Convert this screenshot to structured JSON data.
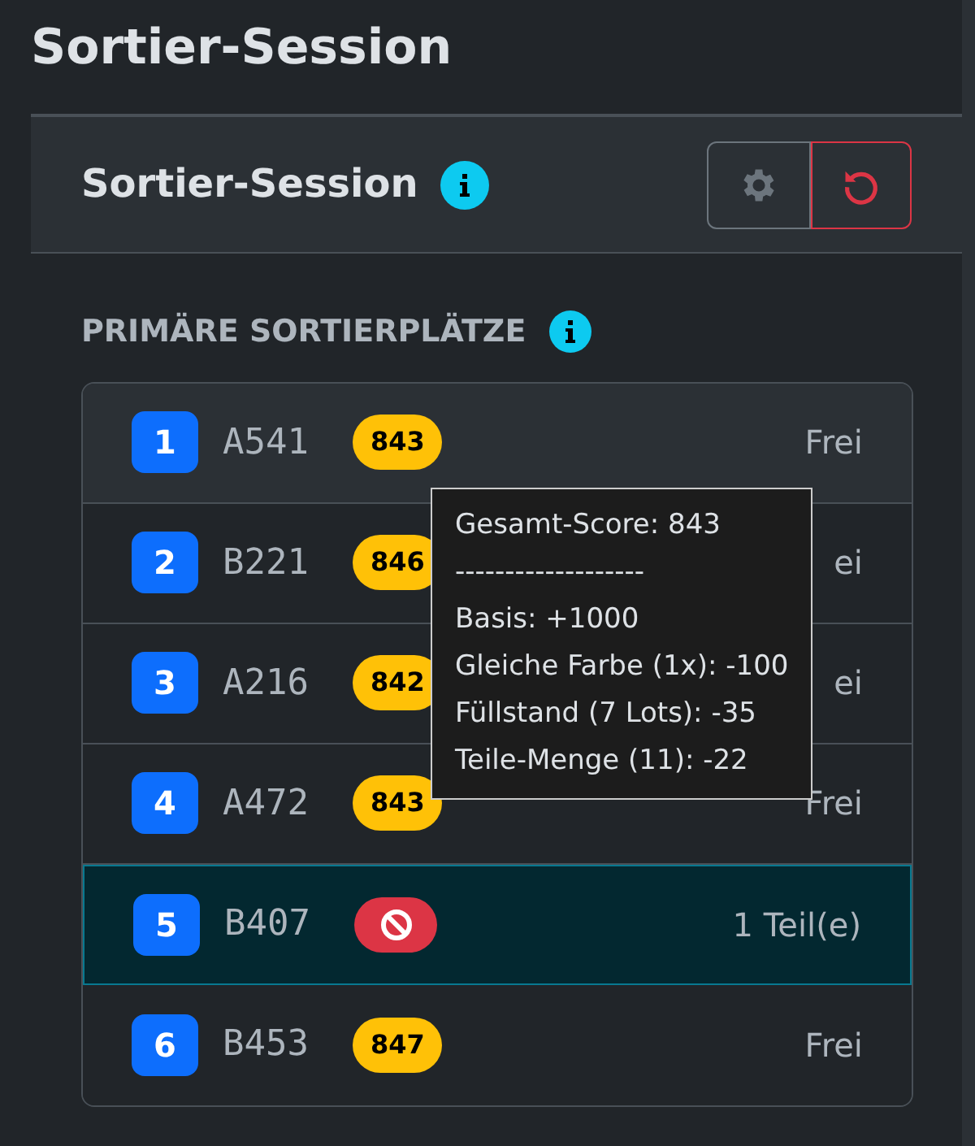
{
  "page_title": "Sortier-Session",
  "card": {
    "title": "Sortier-Session",
    "section_label": "PRIMÄRE SORTIERPLÄTZE"
  },
  "slots": [
    {
      "number": "1",
      "code": "A541",
      "kind": "score",
      "score": "843",
      "status": "Frei",
      "hovered": true,
      "selected": false
    },
    {
      "number": "2",
      "code": "B221",
      "kind": "score",
      "score": "846",
      "status": "ei",
      "hovered": false,
      "selected": false
    },
    {
      "number": "3",
      "code": "A216",
      "kind": "score",
      "score": "842",
      "status": "ei",
      "hovered": false,
      "selected": false
    },
    {
      "number": "4",
      "code": "A472",
      "kind": "score",
      "score": "843",
      "status": "Frei",
      "hovered": false,
      "selected": false
    },
    {
      "number": "5",
      "code": "B407",
      "kind": "blocked",
      "status": "1 Teil(e)",
      "hovered": false,
      "selected": true
    },
    {
      "number": "6",
      "code": "B453",
      "kind": "score",
      "score": "847",
      "status": "Frei",
      "hovered": false,
      "selected": false
    }
  ],
  "tooltip": {
    "lines": [
      "Gesamt-Score: 843",
      "-------------------",
      "Basis: +1000",
      "Gleiche Farbe (1x): -100",
      "Füllstand (7 Lots): -35",
      "Teile-Menge (11): -22"
    ]
  }
}
